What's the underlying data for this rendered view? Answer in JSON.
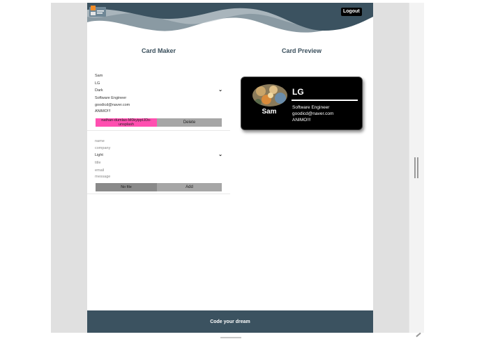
{
  "header": {
    "logout_label": "Logout"
  },
  "maker": {
    "title": "Card Maker",
    "card1": {
      "name": "Sam",
      "company": "LG",
      "theme": "Dark",
      "title": "Software Engineer",
      "email": "goodicd@naver.com",
      "message": "ANIMO!!!",
      "file_label": "nathan-dumlao-M0kyipplJDs-unsplash",
      "action_label": "Delete"
    },
    "card2": {
      "name_placeholder": "name",
      "company_placeholder": "company",
      "theme": "Light",
      "title_placeholder": "title",
      "email_placeholder": "email",
      "message_placeholder": "message",
      "file_label": "No file",
      "action_label": "Add"
    }
  },
  "preview": {
    "title": "Card Preview",
    "card": {
      "name": "Sam",
      "company": "LG",
      "title": "Software Engineer",
      "email": "goodicd@naver.com",
      "message": "ANIMO!!!"
    }
  },
  "footer": {
    "text": "Code your dream"
  },
  "colors": {
    "header_wave_dark": "#3b5260",
    "header_wave_light": "#8a9aa3",
    "footer_bg": "#3b5260",
    "file_button_pink": "#ff4fb0",
    "card_bg": "#000000"
  }
}
